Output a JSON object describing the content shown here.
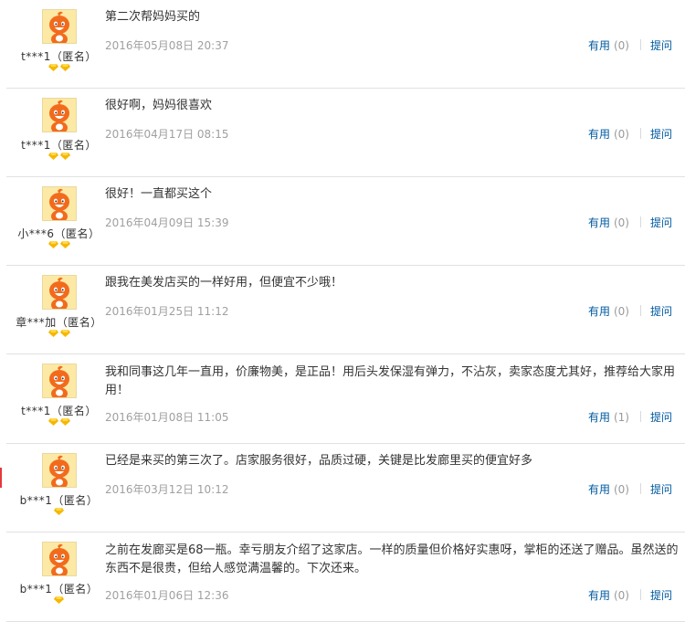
{
  "colors": {
    "accent": "#005aa0",
    "date": "#a0a0a0",
    "gem": "#f5b800",
    "divider": "#e1e1e1",
    "avatar_bg": "#fde9a6",
    "mascot": "#f26b1d"
  },
  "reviews": [
    {
      "user": "t***1（匿名）",
      "gems": 2,
      "content": "第二次帮妈妈买的",
      "date": "2016年05月08日 20:37",
      "useful_label": "有用",
      "useful_count": "(0)",
      "ask_label": "提问"
    },
    {
      "user": "t***1（匿名）",
      "gems": 2,
      "content": "很好啊，妈妈很喜欢",
      "date": "2016年04月17日 08:15",
      "useful_label": "有用",
      "useful_count": "(0)",
      "ask_label": "提问"
    },
    {
      "user": "小***6（匿名）",
      "gems": 2,
      "content": "很好！一直都买这个",
      "date": "2016年04月09日 15:39",
      "useful_label": "有用",
      "useful_count": "(0)",
      "ask_label": "提问"
    },
    {
      "user": "章***加（匿名）",
      "gems": 2,
      "content": "跟我在美发店买的一样好用，但便宜不少哦！",
      "date": "2016年01月25日 11:12",
      "useful_label": "有用",
      "useful_count": "(0)",
      "ask_label": "提问"
    },
    {
      "user": "t***1（匿名）",
      "gems": 2,
      "content": "我和同事这几年一直用，价廉物美，是正品！用后头发保湿有弹力，不沾灰，卖家态度尤其好，推荐给大家用用！",
      "date": "2016年01月08日 11:05",
      "useful_label": "有用",
      "useful_count": "(1)",
      "ask_label": "提问"
    },
    {
      "user": "b***1（匿名）",
      "gems": 1,
      "content": "已经是来买的第三次了。店家服务很好，品质过硬，关键是比发廊里买的便宜好多",
      "date": "2016年03月12日 10:12",
      "useful_label": "有用",
      "useful_count": "(0)",
      "ask_label": "提问"
    },
    {
      "user": "b***1（匿名）",
      "gems": 1,
      "content": "之前在发廊买是68一瓶。幸亏朋友介绍了这家店。一样的质量但价格好实惠呀，掌柜的还送了赠品。虽然送的东西不是很贵，但给人感觉满温馨的。下次还来。",
      "date": "2016年01月06日 12:36",
      "useful_label": "有用",
      "useful_count": "(0)",
      "ask_label": "提问"
    }
  ]
}
